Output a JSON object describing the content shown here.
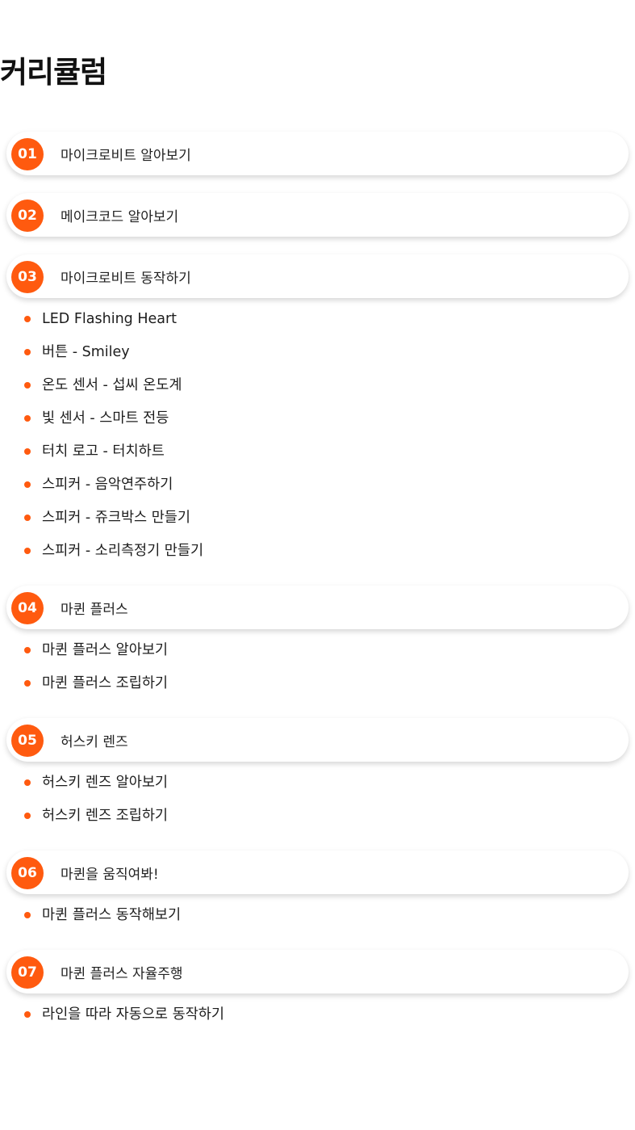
{
  "page": {
    "title": "커리큘럼"
  },
  "accent_color": "#ff5a0f",
  "sections": [
    {
      "number": "01",
      "title": "마이크로비트 알아보기",
      "items": []
    },
    {
      "number": "02",
      "title": "메이크코드 알아보기",
      "items": []
    },
    {
      "number": "03",
      "title": "마이크로비트 동작하기",
      "items": [
        "LED Flashing Heart",
        "버튼 - Smiley",
        "온도 센서 - 섭씨 온도계",
        "빛 센서 - 스마트 전등",
        "터치 로고 - 터치하트",
        "스피커 - 음악연주하기",
        "스피커 - 쥬크박스 만들기",
        "스피커 - 소리측정기 만들기"
      ]
    },
    {
      "number": "04",
      "title": "마퀸 플러스",
      "items": [
        "마퀸 플러스 알아보기",
        "마퀸 플러스 조립하기"
      ]
    },
    {
      "number": "05",
      "title": "허스키 렌즈",
      "items": [
        "허스키 렌즈 알아보기",
        "허스키 렌즈 조립하기"
      ]
    },
    {
      "number": "06",
      "title": "마퀸을 움직여봐!",
      "items": [
        "마퀸 플러스 동작해보기"
      ]
    },
    {
      "number": "07",
      "title": "마퀸 플러스 자율주행",
      "items": [
        "라인을 따라 자동으로 동작하기"
      ]
    }
  ]
}
